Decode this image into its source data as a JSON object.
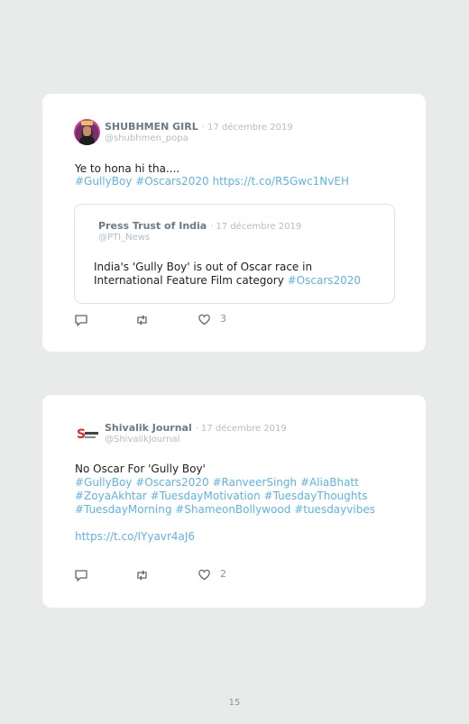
{
  "tweets": [
    {
      "author": "SHUBHMEN GIRL",
      "date": "· 17 décembre 2019",
      "handle": "@shubhmen_popa",
      "avatar_icon": "profile-photo-woman",
      "text_line1": "Ye to hona hi tha....",
      "links_line2": "#GullyBoy #Oscars2020 https://t.co/R5Gwc1NvEH",
      "quote": {
        "author": "Press Trust of India",
        "date": "· 17 décembre 2019",
        "handle": "@PTI_News",
        "line1": "India's 'Gully Boy' is out of Oscar race in",
        "line2_text": "International Feature Film category ",
        "line2_link": "#Oscars2020"
      },
      "likes": "3"
    },
    {
      "author": "Shivalik Journal",
      "date": "· 17 décembre 2019",
      "handle": "@ShivalikJournal",
      "avatar_icon": "shivalik-journal-logo",
      "text_line1": "No Oscar For 'Gully Boy'",
      "links_line2": "#GullyBoy #Oscars2020 #RanveerSingh #AliaBhatt",
      "links_line3": "#ZoyaAkhtar #TuesdayMotivation #TuesdayThoughts",
      "links_line4": "#TuesdayMorning #ShameonBollywood #tuesdayvibes",
      "url": "https://t.co/IYyavr4aJ6",
      "likes": "2"
    }
  ],
  "icons": {
    "reply": "reply-icon",
    "retweet": "retweet-icon",
    "like": "heart-icon"
  },
  "colors": {
    "link": "#5fb3e6",
    "author": "#6b7a87",
    "muted": "#b5bcc2",
    "background": "#e9ebeb",
    "card": "#ffffff"
  },
  "page_number": "15"
}
